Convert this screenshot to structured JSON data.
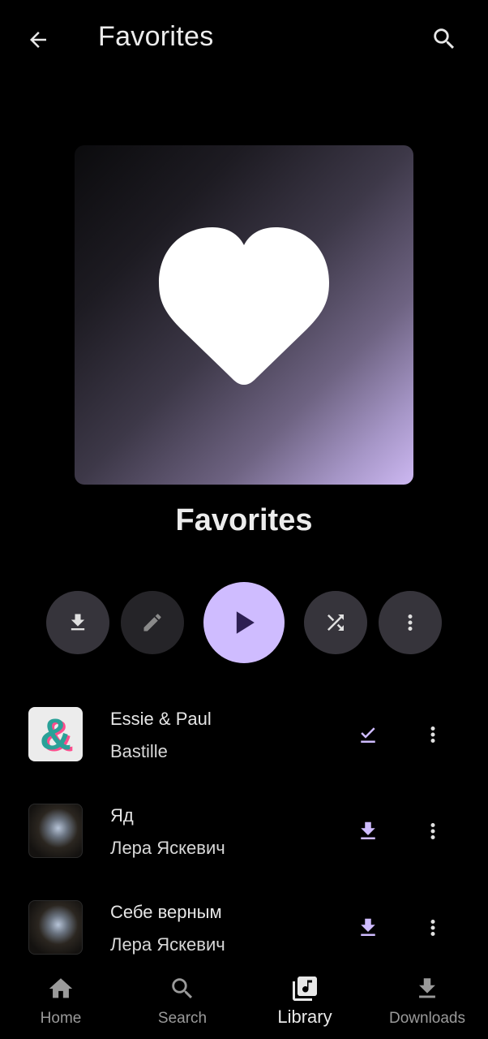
{
  "header": {
    "title": "Favorites"
  },
  "playlist": {
    "name": "Favorites"
  },
  "tracks": [
    {
      "title": "Essie & Paul",
      "artist": "Bastille",
      "downloaded": true
    },
    {
      "title": "Яд",
      "artist": "Лера Яскевич",
      "downloaded": false
    },
    {
      "title": "Себе верным",
      "artist": "Лера Яскевич",
      "downloaded": false
    }
  ],
  "nav": {
    "home": "Home",
    "search": "Search",
    "library": "Library",
    "downloads": "Downloads"
  },
  "colors": {
    "accent": "#cfbcff",
    "background": "#000000"
  },
  "icons": [
    "arrow-back-icon",
    "search-icon",
    "heart-icon",
    "download-icon",
    "edit-icon",
    "play-icon",
    "shuffle-icon",
    "more-vert-icon",
    "check-download-icon",
    "home-icon",
    "library-icon",
    "downloads-icon"
  ]
}
